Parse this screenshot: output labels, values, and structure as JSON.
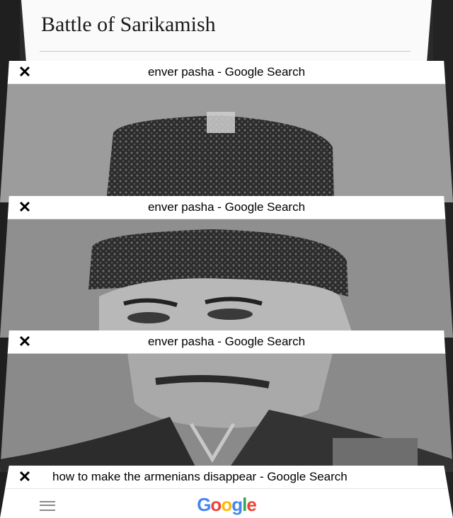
{
  "wiki": {
    "title": "Battle of Sarikamish"
  },
  "tabs": [
    {
      "title": "enver pasha - Google Search",
      "close": "✕"
    },
    {
      "title": "enver pasha - Google Search",
      "close": "✕"
    },
    {
      "title": "enver pasha - Google Search",
      "close": "✕"
    },
    {
      "title": "how to make the armenians disappear - Google Search",
      "close": "✕"
    }
  ],
  "google_logo": [
    "G",
    "o",
    "o",
    "g",
    "l",
    "e"
  ],
  "colors": {
    "google_blue": "#4285F4",
    "google_red": "#EA4335",
    "google_yellow": "#FBBC05",
    "google_green": "#34A853"
  }
}
